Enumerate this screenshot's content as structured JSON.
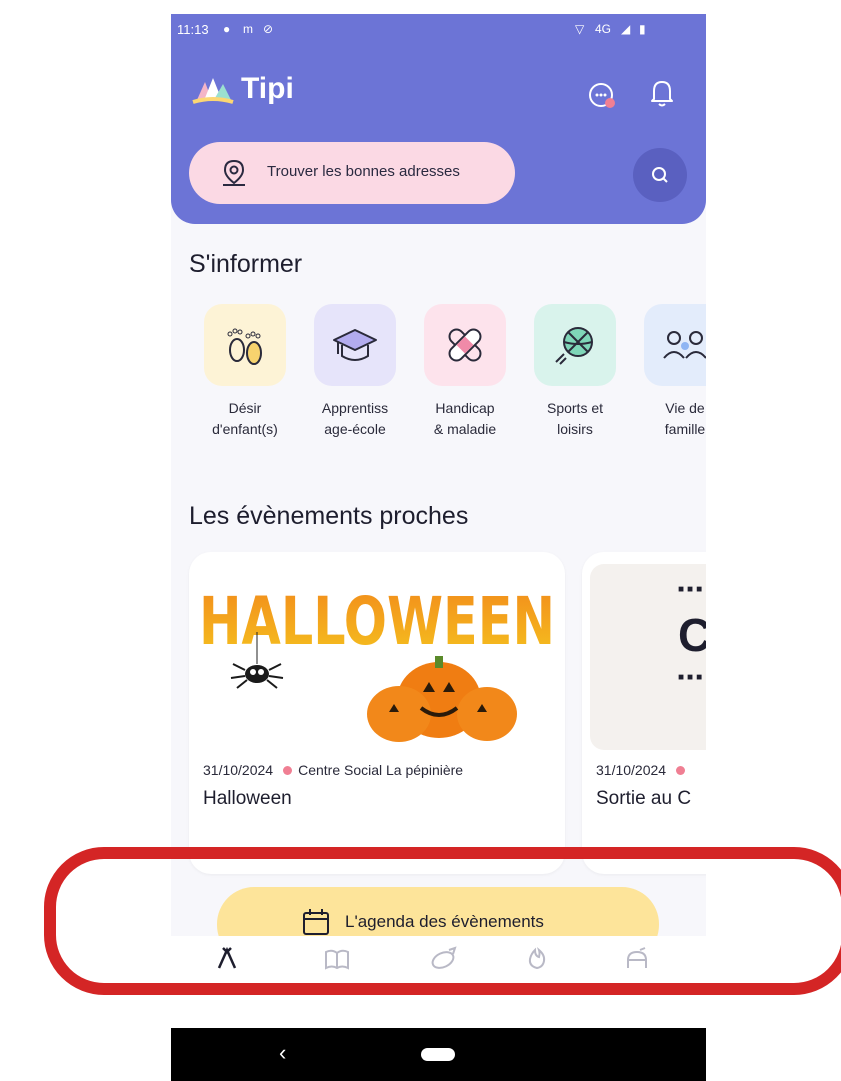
{
  "status_bar": {
    "time": "11:13",
    "network": "4G"
  },
  "header": {
    "app_title": "Tipi",
    "search_placeholder": "Trouver les bonnes adresses"
  },
  "sections": {
    "inform_title": "S'informer",
    "events_title": "Les évènements proches"
  },
  "categories": [
    {
      "label": "Désir\nd'enfant(s)",
      "icon": "baby-feet-icon",
      "bg": "#fdf3d6"
    },
    {
      "label": "Apprentiss\nage-école",
      "icon": "graduation-cap-icon",
      "bg": "#e6e4fa"
    },
    {
      "label": "Handicap\n& maladie",
      "icon": "bandage-icon",
      "bg": "#fde3ec"
    },
    {
      "label": "Sports et\nloisirs",
      "icon": "ball-icon",
      "bg": "#d9f3ec"
    },
    {
      "label": "Vie de\nfamille",
      "icon": "family-icon",
      "bg": "#e3ecfb"
    }
  ],
  "events": [
    {
      "image_text": "HALLOWEEN",
      "date": "31/10/2024",
      "place": "Centre Social La pépinière",
      "name": "Halloween"
    },
    {
      "image_text": "C",
      "date": "31/10/2024",
      "place": "",
      "name": "Sortie au C"
    }
  ],
  "agenda_button": "L'agenda des évènements",
  "nav": [
    {
      "label": "Accueil",
      "icon": "home-tent-icon",
      "active": true
    },
    {
      "label": "S'informer",
      "icon": "book-icon",
      "active": false
    },
    {
      "label": "Jouer",
      "icon": "rocket-icon",
      "active": false
    },
    {
      "label": "Discuter",
      "icon": "flame-icon",
      "active": false
    },
    {
      "label": "Profil",
      "icon": "profile-icon",
      "active": false
    }
  ],
  "colors": {
    "header": "#6c74d6",
    "pill": "#fbd9e4",
    "agenda": "#fde49a",
    "annotation": "#d42525",
    "nav_active": "#1e1e2e",
    "nav_inactive": "#b9b9c6"
  }
}
